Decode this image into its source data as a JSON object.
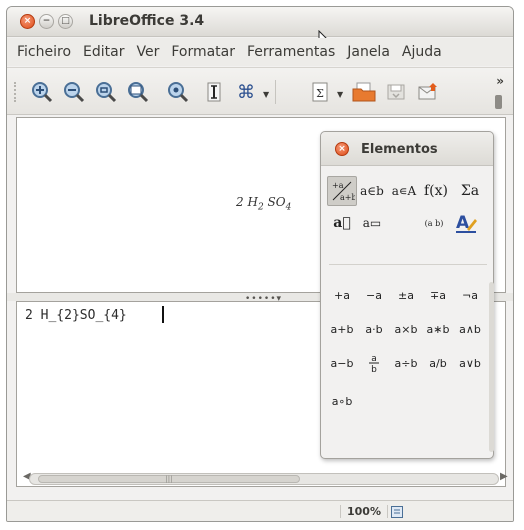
{
  "window": {
    "title": "LibreOffice 3.4"
  },
  "menu": [
    "Ficheiro",
    "Editar",
    "Ver",
    "Formatar",
    "Ferramentas",
    "Janela",
    "Ajuda"
  ],
  "toolbar": {
    "more": "»",
    "icons": [
      "zoom-in-icon",
      "zoom-out-icon",
      "zoom-100-icon",
      "show-all-icon",
      "zoom-page-icon",
      "cursor-icon",
      "symbols-icon",
      "sum-icon",
      "open-icon",
      "save-icon",
      "export-icon"
    ]
  },
  "formula_view": {
    "display": {
      "coef": "2",
      "h": "H",
      "h_sub": "2",
      "so": "SO",
      "so_sub": "4"
    }
  },
  "command": {
    "text": "2 H_{2}SO_{4}"
  },
  "status": {
    "zoom": "100%"
  },
  "elements": {
    "title": "Elementos",
    "categories": [
      {
        "label": "+a a+b",
        "name": "unary-binary-category"
      },
      {
        "label": "a∈b",
        "name": "relations-category"
      },
      {
        "label": "a∊A",
        "name": "set-operations-category"
      },
      {
        "label": "f(x)",
        "name": "functions-category"
      },
      {
        "label": "Σa",
        "name": "operators-category"
      },
      {
        "label": "a⃗",
        "name": "attributes-category"
      },
      {
        "label": "a▭",
        "name": "others-category"
      },
      {
        "label": "(a b)",
        "name": "brackets-category"
      },
      {
        "label": "A",
        "name": "formats-category"
      }
    ],
    "operators": [
      "+a",
      "−a",
      "±a",
      "∓a",
      "¬a",
      "a+b",
      "a·b",
      "a×b",
      "a∗b",
      "a∧b",
      "a−b",
      "a/b",
      "a÷b",
      "a/b",
      "a∨b",
      "a∘b"
    ]
  }
}
